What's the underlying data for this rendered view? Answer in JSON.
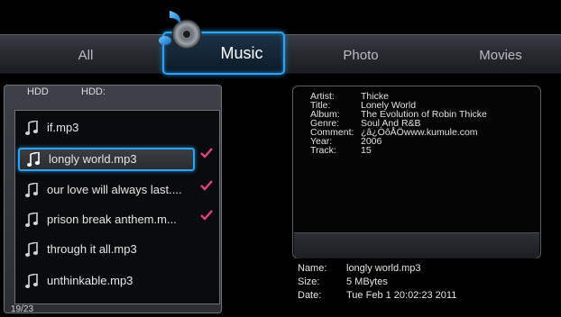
{
  "tabs": {
    "all": "All",
    "music": "Music",
    "photo": "Photo",
    "movies": "Movies"
  },
  "browser": {
    "hdd_label": "HDD",
    "hdd_path": "HDD:",
    "counter": "19/23",
    "items": [
      {
        "name": "if.mp3",
        "checked": false
      },
      {
        "name": "longly world.mp3",
        "checked": true,
        "selected": true
      },
      {
        "name": "our love will always last....",
        "checked": true
      },
      {
        "name": "prison break anthem.m...",
        "checked": true
      },
      {
        "name": "through it all.mp3",
        "checked": false
      },
      {
        "name": "unthinkable.mp3",
        "checked": false
      }
    ]
  },
  "info": {
    "artist_label": "Artist:",
    "artist": "Thicke",
    "title_label": "Title:",
    "title": "Lonely World",
    "album_label": "Album:",
    "album": "The Evolution of Robin Thicke",
    "genre_label": "Genre:",
    "genre": "Soul And R&B",
    "comment_label": "Comment:",
    "comment": "¿â¿ÒôÅÖwww.kumule.com",
    "year_label": "Year:",
    "year": "2006",
    "track_label": "Track:",
    "track": "15"
  },
  "details": {
    "name_label": "Name:",
    "name": "longly world.mp3",
    "size_label": "Size:",
    "size": "5 MBytes",
    "date_label": "Date:",
    "date": "Tue Feb  1 20:02:23 2011"
  },
  "colors": {
    "accent": "#2ea3ef",
    "check": "#e0457b"
  },
  "icons": {
    "music_tab": "music-note-disc-icon",
    "file": "music-note-icon",
    "check": "checkmark-icon"
  }
}
